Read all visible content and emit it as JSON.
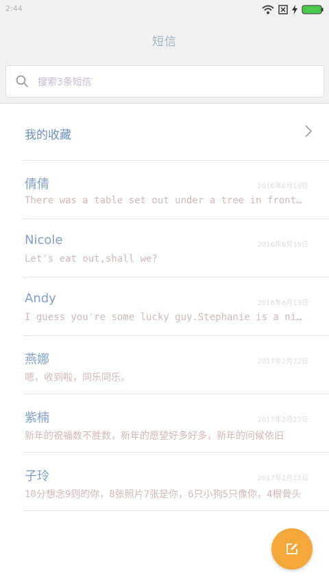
{
  "status_bar": {
    "time": "2:44"
  },
  "header": {
    "title": "短信"
  },
  "search": {
    "placeholder": "搜索3条短信"
  },
  "favorites": {
    "label": "我的收藏"
  },
  "conversations": [
    {
      "name": "倩倩",
      "date": "2016年6月19日",
      "preview": "There was a table set out under a tree in front of the house"
    },
    {
      "name": "Nicole",
      "date": "2016年6月19日",
      "preview": "Let's eat out,shall we?"
    },
    {
      "name": "Andy",
      "date": "2016年6月19日",
      "preview": "I guess you're some lucky guy.Stephanie is a nice girl"
    },
    {
      "name": "燕娜",
      "date": "2017年2月22日",
      "preview": "嗯，收到啦，同乐同乐。"
    },
    {
      "name": "紫楠",
      "date": "2017年2月22日",
      "preview": "新年的祝福数不胜数，新年的愿望好多好多，新年的问候依旧"
    },
    {
      "name": "子玲",
      "date": "2017年2月22日",
      "preview": "10分想念9则的你，8张照片7张是你，6只小狗5只像你，4根骨头"
    }
  ],
  "colors": {
    "accent": "#f5a83a",
    "background": "#f1f1f1"
  }
}
